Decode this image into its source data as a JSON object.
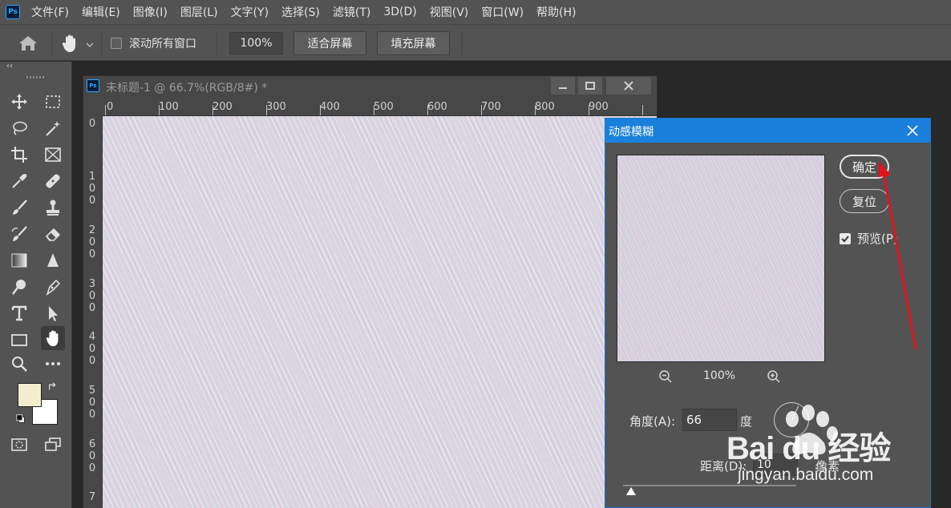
{
  "menu": {
    "items": [
      "文件(F)",
      "编辑(E)",
      "图像(I)",
      "图层(L)",
      "文字(Y)",
      "选择(S)",
      "滤镜(T)",
      "3D(D)",
      "视图(V)",
      "窗口(W)",
      "帮助(H)"
    ]
  },
  "app_logo": "Ps",
  "options": {
    "scroll_all_label": "滚动所有窗口",
    "zoom_value": "100%",
    "fit_screen_label": "适合屏幕",
    "fill_screen_label": "填充屏幕"
  },
  "toolbar": {
    "collapse": "‹‹",
    "foreground_color": "#f3eed0",
    "background_color": "#ffffff"
  },
  "document": {
    "title": "未标题-1 @ 66.7%(RGB/8#) *",
    "ruler_h": [
      "0",
      "100",
      "200",
      "300",
      "400",
      "500",
      "600",
      "700",
      "800",
      "900"
    ],
    "ruler_v": [
      "0",
      "100",
      "200",
      "300",
      "400",
      "500",
      "600",
      "7"
    ]
  },
  "dialog": {
    "title": "动感模糊",
    "ok_label": "确定",
    "reset_label": "复位",
    "preview_label": "预览(P)",
    "preview_checked": true,
    "zoom_percent": "100%",
    "angle_label": "角度(A):",
    "angle_value": "66",
    "angle_unit": "度",
    "distance_label": "距离(D):",
    "distance_value": "10",
    "distance_unit": "像素"
  },
  "watermark": {
    "brand": "Bai du 经验",
    "url": "jingyan.baidu.com"
  },
  "accent_colors": {
    "dialog_title_bg": "#1a80dc",
    "annotation_arrow": "#e0141e"
  }
}
